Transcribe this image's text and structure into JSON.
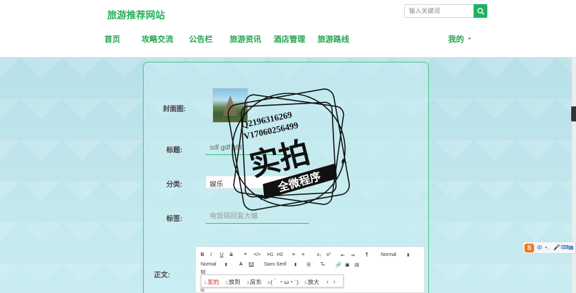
{
  "header": {
    "site_title": "旅游推荐网站",
    "search_placeholder": "输入关键词",
    "nav": [
      "首页",
      "攻略交流",
      "公告栏",
      "旅游资讯",
      "酒店管理",
      "旅游路线"
    ],
    "user_menu": "我的"
  },
  "form": {
    "cover_label": "封面图:",
    "title_label": "标题:",
    "title_value": "sdf gdf gfd",
    "category_label": "分类:",
    "category_value": "娱乐",
    "tags_label": "标签:",
    "tags_placeholder": "电饭锅回复大幅",
    "content_label": "正文:"
  },
  "editor": {
    "toolbar_row1": [
      "B",
      "I",
      "U",
      "S",
      "❞",
      "</>",
      "H1",
      "H2",
      "≡",
      "≡",
      "x₂",
      "x²",
      "⇤",
      "⇥",
      "¶",
      "Normal"
    ],
    "toolbar_row2": [
      "Normal",
      "A",
      "A",
      "Sans Serif"
    ],
    "typed_text": "fd",
    "second_line": "fd"
  },
  "ime": {
    "candidates": [
      {
        "n": "1",
        "text": "发的"
      },
      {
        "n": "2",
        "text": "放到"
      },
      {
        "n": "3",
        "text": "房东"
      },
      {
        "n": "4",
        "text": "(｀・ω・´)"
      },
      {
        "n": "5",
        "text": "放大"
      }
    ],
    "nav_prev": "‹",
    "nav_next": "›"
  },
  "sogou": {
    "logo": "S",
    "items": [
      "中",
      "•,",
      "🎤",
      "⌨",
      "▦",
      "⁂"
    ]
  },
  "watermark": {
    "line1": "Q2196316269",
    "line2": "V17060256499",
    "big": "实拍",
    "banner": "全微程序"
  },
  "colors": {
    "brand": "#27b05a",
    "border": "#4cc382",
    "accent_button": "#21b261"
  }
}
